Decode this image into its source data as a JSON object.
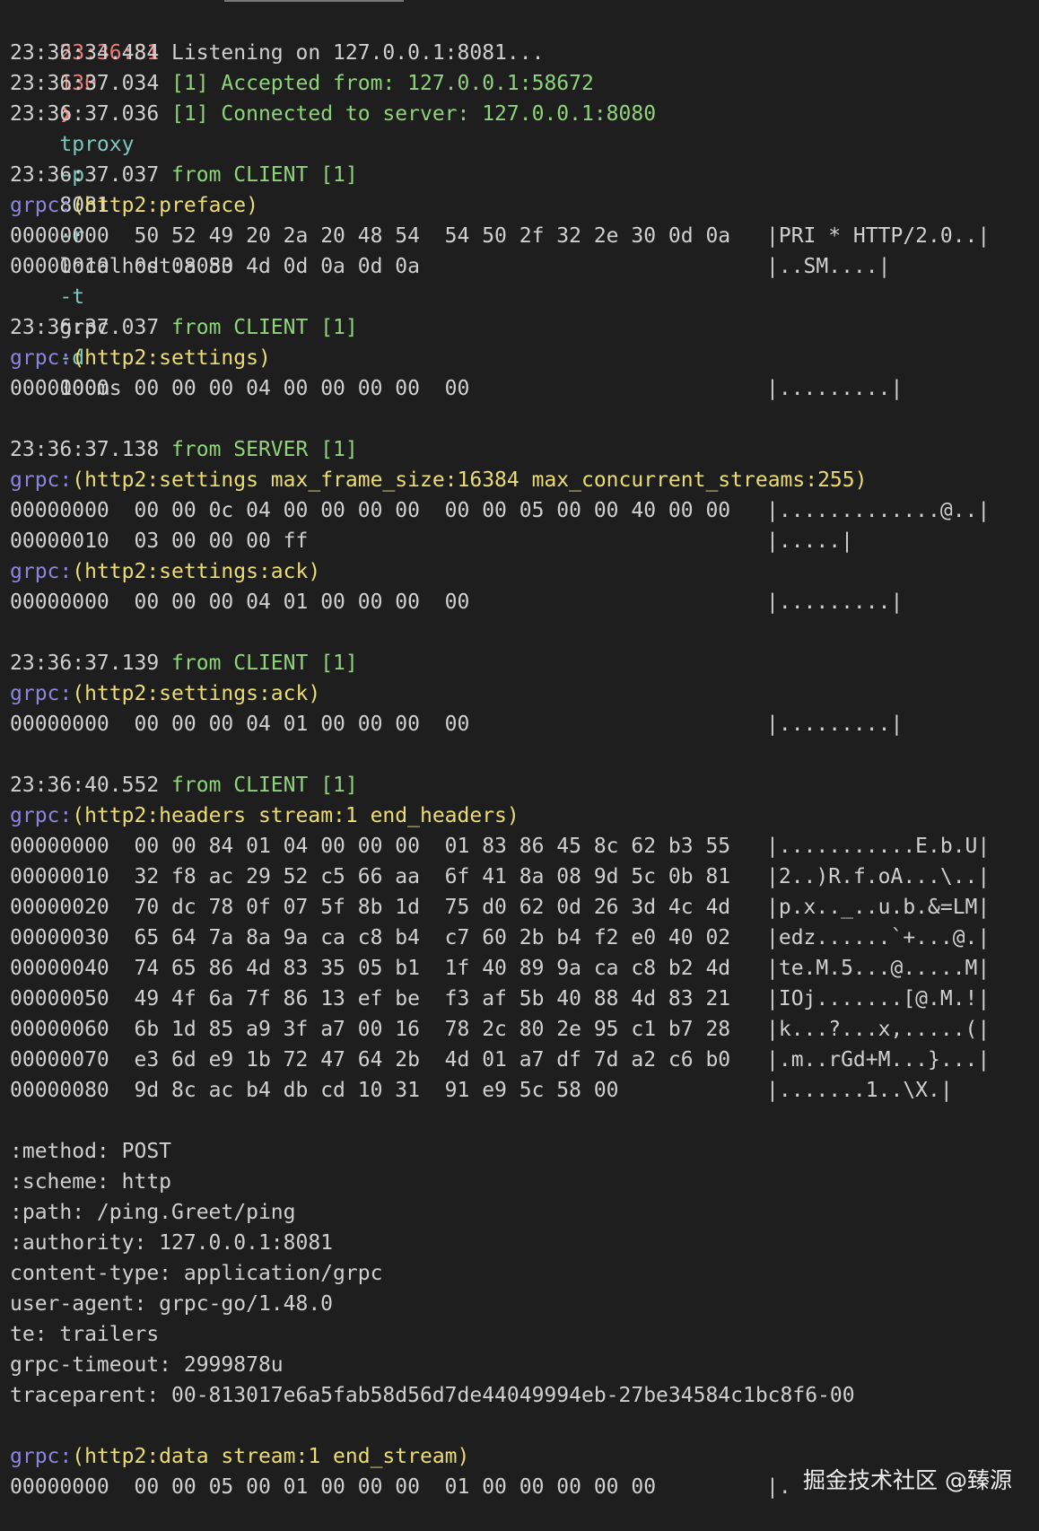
{
  "prompt": {
    "time": "23:36:31",
    "status": "130",
    "arrow": "❯",
    "cmd": "tproxy",
    "args": [
      {
        "flag": "-p",
        "value": "8081"
      },
      {
        "flag": "-r",
        "value": "localhost:8080"
      },
      {
        "flag": "-t",
        "value": "grpc"
      },
      {
        "flag": "-d",
        "value": "100ms"
      }
    ]
  },
  "log": {
    "listening": {
      "time": "23:36:34.484",
      "text": "Listening on 127.0.0.1:8081..."
    },
    "accepted": {
      "time": "23:36:37.034",
      "text": "[1] Accepted from: 127.0.0.1:58672"
    },
    "connected": {
      "time": "23:36:37.036",
      "text": "[1] Connected to server: 127.0.0.1:8080"
    }
  },
  "blocks": [
    {
      "time": "23:36:37.037",
      "from": "from CLIENT [1]",
      "frames": [
        {
          "kind": "(http2:preface)",
          "rows": [
            {
              "off": "00000000",
              "hex": "50 52 49 20 2a 20 48 54  54 50 2f 32 2e 30 0d 0a",
              "ascii": "|PRI * HTTP/2.0..|"
            },
            {
              "off": "00000010",
              "hex": "0d 0a 53 4d 0d 0a 0d 0a",
              "ascii": "|..SM....|"
            }
          ]
        }
      ]
    },
    {
      "time": "23:36:37.037",
      "from": "from CLIENT [1]",
      "frames": [
        {
          "kind": "(http2:settings)",
          "rows": [
            {
              "off": "00000000",
              "hex": "00 00 00 04 00 00 00 00  00",
              "ascii": "|.........|"
            }
          ]
        }
      ]
    },
    {
      "time": "23:36:37.138",
      "from": "from SERVER [1]",
      "frames": [
        {
          "kind": "(http2:settings max_frame_size:16384 max_concurrent_streams:255)",
          "rows": [
            {
              "off": "00000000",
              "hex": "00 00 0c 04 00 00 00 00  00 00 05 00 00 40 00 00",
              "ascii": "|.............@..|"
            },
            {
              "off": "00000010",
              "hex": "03 00 00 00 ff",
              "ascii": "|.....|"
            }
          ]
        },
        {
          "kind": "(http2:settings:ack)",
          "rows": [
            {
              "off": "00000000",
              "hex": "00 00 00 04 01 00 00 00  00",
              "ascii": "|.........|"
            }
          ]
        }
      ]
    },
    {
      "time": "23:36:37.139",
      "from": "from CLIENT [1]",
      "frames": [
        {
          "kind": "(http2:settings:ack)",
          "rows": [
            {
              "off": "00000000",
              "hex": "00 00 00 04 01 00 00 00  00",
              "ascii": "|.........|"
            }
          ]
        }
      ]
    },
    {
      "time": "23:36:40.552",
      "from": "from CLIENT [1]",
      "frames": [
        {
          "kind": "(http2:headers stream:1 end_headers)",
          "rows": [
            {
              "off": "00000000",
              "hex": "00 00 84 01 04 00 00 00  01 83 86 45 8c 62 b3 55",
              "ascii": "|...........E.b.U|"
            },
            {
              "off": "00000010",
              "hex": "32 f8 ac 29 52 c5 66 aa  6f 41 8a 08 9d 5c 0b 81",
              "ascii": "|2..)R.f.oA...\\..|"
            },
            {
              "off": "00000020",
              "hex": "70 dc 78 0f 07 5f 8b 1d  75 d0 62 0d 26 3d 4c 4d",
              "ascii": "|p.x.._..u.b.&=LM|"
            },
            {
              "off": "00000030",
              "hex": "65 64 7a 8a 9a ca c8 b4  c7 60 2b b4 f2 e0 40 02",
              "ascii": "|edz......`+...@.|"
            },
            {
              "off": "00000040",
              "hex": "74 65 86 4d 83 35 05 b1  1f 40 89 9a ca c8 b2 4d",
              "ascii": "|te.M.5...@.....M|"
            },
            {
              "off": "00000050",
              "hex": "49 4f 6a 7f 86 13 ef be  f3 af 5b 40 88 4d 83 21",
              "ascii": "|IOj.......[@.M.!|"
            },
            {
              "off": "00000060",
              "hex": "6b 1d 85 a9 3f a7 00 16  78 2c 80 2e 95 c1 b7 28",
              "ascii": "|k...?...x,.....(|"
            },
            {
              "off": "00000070",
              "hex": "e3 6d e9 1b 72 47 64 2b  4d 01 a7 df 7d a2 c6 b0",
              "ascii": "|.m..rGd+M...}...|"
            },
            {
              "off": "00000080",
              "hex": "9d 8c ac b4 db cd 10 31  91 e9 5c 58 00",
              "ascii": "|.......1..\\X.|"
            }
          ]
        }
      ]
    }
  ],
  "headers": [
    ":method: POST",
    ":scheme: http",
    ":path: /ping.Greet/ping",
    ":authority: 127.0.0.1:8081",
    "content-type: application/grpc",
    "user-agent: grpc-go/1.48.0",
    "te: trailers",
    "grpc-timeout: 2999878u",
    "traceparent: 00-813017e6a5fab58d56d7de44049994eb-27be34584c1bc8f6-00"
  ],
  "last_frame": {
    "prefix": "grpc:",
    "kind": "(http2:data stream:1 end_stream)",
    "row": {
      "off": "00000000",
      "hex": "00 00 05 00 01 00 00 00  01 00 00 00 00 00",
      "ascii": "|."
    }
  },
  "frame_prefix": "grpc:",
  "watermark": "掘金技术社区 @臻源",
  "colors": {
    "background": "#1e1e1e",
    "text": "#d0d0d0",
    "red": "#ef7b78",
    "cyan": "#7cc7c0",
    "green": "#8fd47a",
    "blue": "#8c86e0",
    "yellow": "#ecdd72"
  }
}
